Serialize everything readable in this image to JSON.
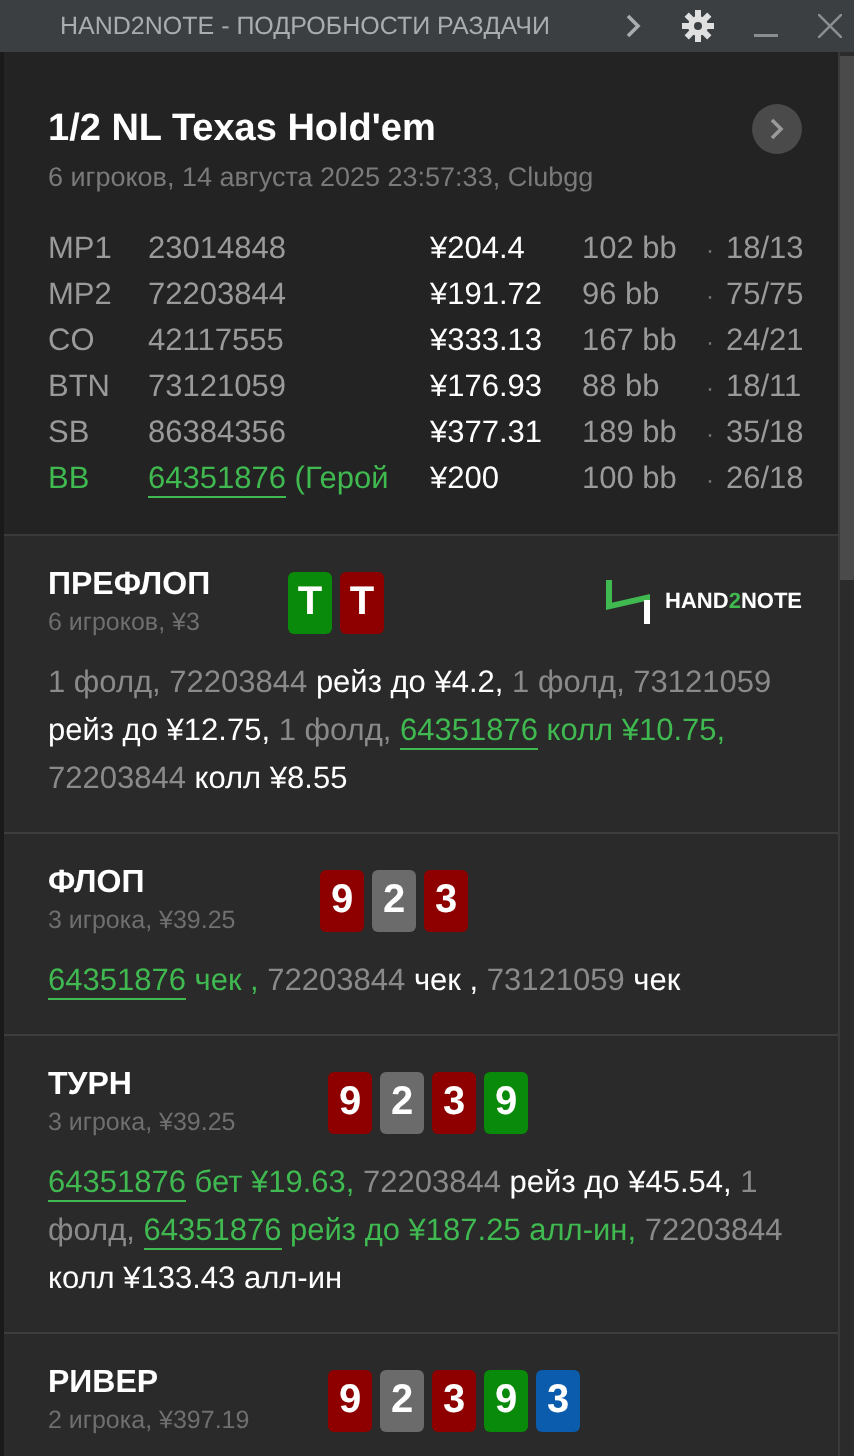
{
  "window": {
    "title": "HAND2NOTE - ПОДРОБНОСТИ РАЗДАЧИ"
  },
  "hand": {
    "title": "1/2 NL Texas Hold'em",
    "subtitle": "6 игроков, 14 августа 2025 23:57:33, Clubgg"
  },
  "players": [
    {
      "position": "MP1",
      "id": "23014848",
      "stack": "¥204.4",
      "bb": "102 bb",
      "sep": "·",
      "stats": "18/13",
      "hero": false
    },
    {
      "position": "MP2",
      "id": "72203844",
      "stack": "¥191.72",
      "bb": "96 bb",
      "sep": "·",
      "stats": "75/75",
      "hero": false
    },
    {
      "position": "CO",
      "id": "42117555",
      "stack": "¥333.13",
      "bb": "167 bb",
      "sep": "·",
      "stats": "24/21",
      "hero": false
    },
    {
      "position": "BTN",
      "id": "73121059",
      "stack": "¥176.93",
      "bb": "88 bb",
      "sep": "·",
      "stats": "18/11",
      "hero": false
    },
    {
      "position": "SB",
      "id": "86384356",
      "stack": "¥377.31",
      "bb": "189 bb",
      "sep": "·",
      "stats": "35/18",
      "hero": false
    },
    {
      "position": "BB",
      "id": "64351876",
      "note": "(Герой",
      "stack": "¥200",
      "bb": "100 bb",
      "sep": "·",
      "stats": "26/18",
      "hero": true
    }
  ],
  "streets": [
    {
      "name": "ПРЕФЛОП",
      "info": "6 игроков, ¥3",
      "logo": {
        "before": "HAND",
        "accent": "2",
        "after": "NOTE"
      },
      "cards": [
        {
          "rank": "T",
          "color": "#0a8a0a"
        },
        {
          "rank": "T",
          "color": "#8e0000"
        }
      ],
      "actions": [
        {
          "text": "1 фолд, 72203844 ",
          "kind": "muted"
        },
        {
          "text": "рейз до ¥4.2, ",
          "kind": "action"
        },
        {
          "text": "1 фолд, 73121059 ",
          "kind": "muted"
        },
        {
          "text": "рейз до ¥12.75, ",
          "kind": "action"
        },
        {
          "text": "1 фолд, ",
          "kind": "muted"
        },
        {
          "text": "64351876",
          "kind": "hero-link"
        },
        {
          "text": " колл ¥10.75, ",
          "kind": "hero"
        },
        {
          "text": "72203844 ",
          "kind": "muted"
        },
        {
          "text": "колл ¥8.55",
          "kind": "action"
        }
      ]
    },
    {
      "name": "ФЛОП",
      "info": "3 игрока, ¥39.25",
      "cards": [
        {
          "rank": "9",
          "color": "#8e0000"
        },
        {
          "rank": "2",
          "color": "#6b6b6b"
        },
        {
          "rank": "3",
          "color": "#8e0000"
        }
      ],
      "actions": [
        {
          "text": "64351876",
          "kind": "hero-link"
        },
        {
          "text": " чек ,",
          "kind": "hero"
        },
        {
          "text": " 72203844 ",
          "kind": "muted"
        },
        {
          "text": "чек ,",
          "kind": "action"
        },
        {
          "text": " 73121059 ",
          "kind": "muted"
        },
        {
          "text": "чек",
          "kind": "action"
        }
      ]
    },
    {
      "name": "ТУРН",
      "info": "3 игрока, ¥39.25",
      "cards": [
        {
          "rank": "9",
          "color": "#8e0000"
        },
        {
          "rank": "2",
          "color": "#6b6b6b"
        },
        {
          "rank": "3",
          "color": "#8e0000"
        },
        {
          "rank": "9",
          "color": "#0a8a0a"
        }
      ],
      "actions": [
        {
          "text": "64351876",
          "kind": "hero-link"
        },
        {
          "text": " бет ¥19.63,",
          "kind": "hero"
        },
        {
          "text": " 72203844 ",
          "kind": "muted"
        },
        {
          "text": "рейз до ¥45.54,",
          "kind": "action"
        },
        {
          "text": " 1 фолд, ",
          "kind": "muted"
        },
        {
          "text": "64351876",
          "kind": "hero-link"
        },
        {
          "text": " рейз до ¥187.25 алл-ин,",
          "kind": "hero"
        },
        {
          "text": " 72203844 ",
          "kind": "muted"
        },
        {
          "text": "колл ¥133.43 алл-ин",
          "kind": "action"
        }
      ]
    },
    {
      "name": "РИВЕР",
      "info": "2 игрока, ¥397.19",
      "cards": [
        {
          "rank": "9",
          "color": "#8e0000"
        },
        {
          "rank": "2",
          "color": "#6b6b6b"
        },
        {
          "rank": "3",
          "color": "#8e0000"
        },
        {
          "rank": "9",
          "color": "#0a8a0a"
        },
        {
          "rank": "3",
          "color": "#0b5cad"
        }
      ]
    }
  ]
}
